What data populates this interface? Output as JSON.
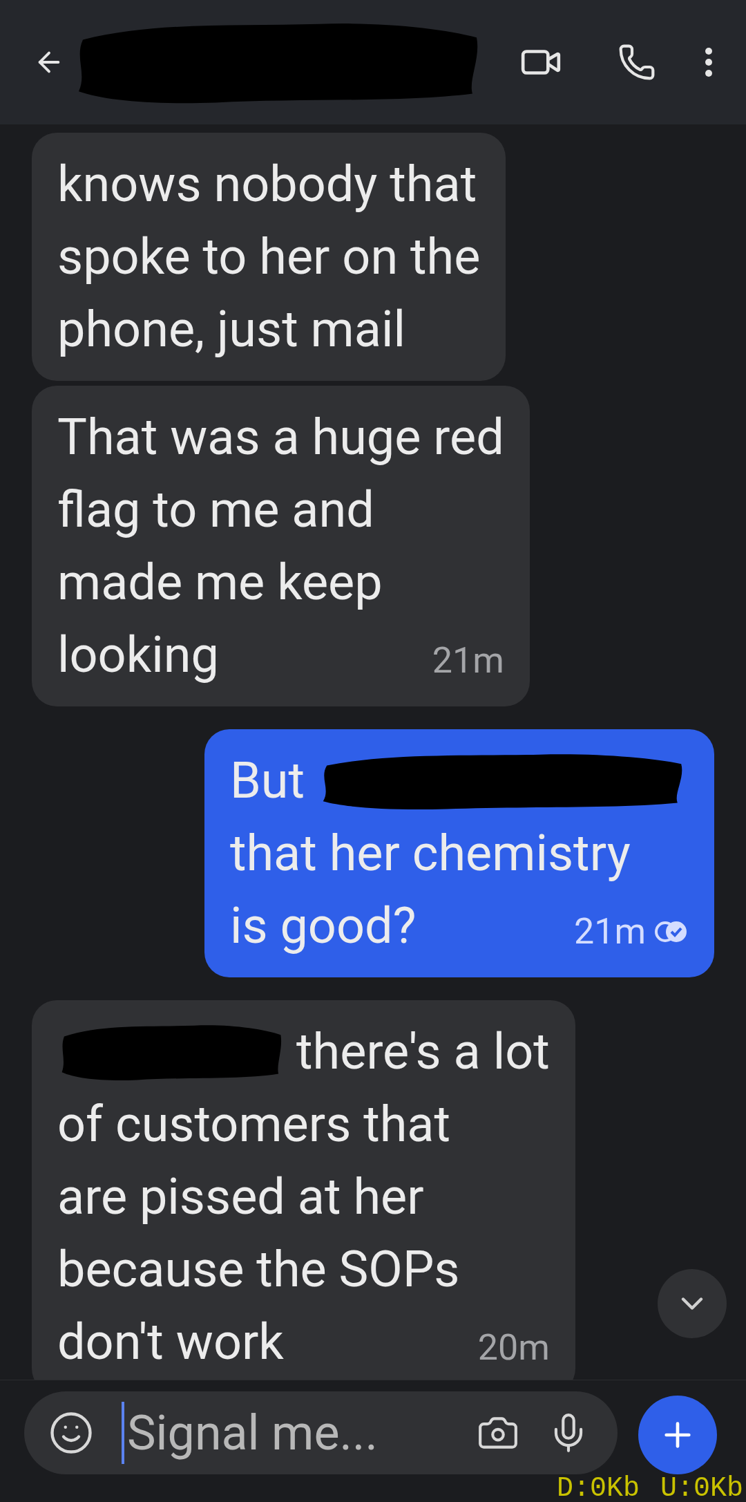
{
  "messages": [
    {
      "outgoing": false,
      "lines": [
        [
          {
            "kind": "text",
            "text": "knows nobody that"
          }
        ],
        [
          {
            "kind": "text",
            "text": "spoke to her on the"
          }
        ],
        [
          {
            "kind": "text",
            "text": "phone, just mail"
          }
        ]
      ]
    },
    {
      "outgoing": false,
      "lines": [
        [
          {
            "kind": "text",
            "text": "That was a huge red"
          }
        ],
        [
          {
            "kind": "text",
            "text": "flag to me and"
          }
        ],
        [
          {
            "kind": "text",
            "text": "made me keep"
          }
        ],
        [
          {
            "kind": "text",
            "text": "looking"
          }
        ]
      ],
      "time": "21m"
    },
    {
      "outgoing": true,
      "lines": [
        [
          {
            "kind": "text",
            "text": "But"
          },
          {
            "kind": "redaction"
          }
        ],
        [
          {
            "kind": "text",
            "text": "that her chemistry"
          }
        ],
        [
          {
            "kind": "text",
            "text": "is good?"
          }
        ]
      ],
      "time": "21m",
      "read": true
    },
    {
      "outgoing": false,
      "lines": [
        [
          {
            "kind": "redaction"
          },
          {
            "kind": "text",
            "text": "there's a lot"
          }
        ],
        [
          {
            "kind": "text",
            "text": "of customers that"
          }
        ],
        [
          {
            "kind": "text",
            "text": "are pissed at her"
          }
        ],
        [
          {
            "kind": "text",
            "text": "because the SOPs"
          }
        ],
        [
          {
            "kind": "text",
            "text": "don't work"
          }
        ]
      ],
      "time": "20m"
    }
  ],
  "composer": {
    "placeholder": "Signal me..."
  },
  "overlay": {
    "download": "D:0Kb",
    "upload": "U:0Kb"
  }
}
